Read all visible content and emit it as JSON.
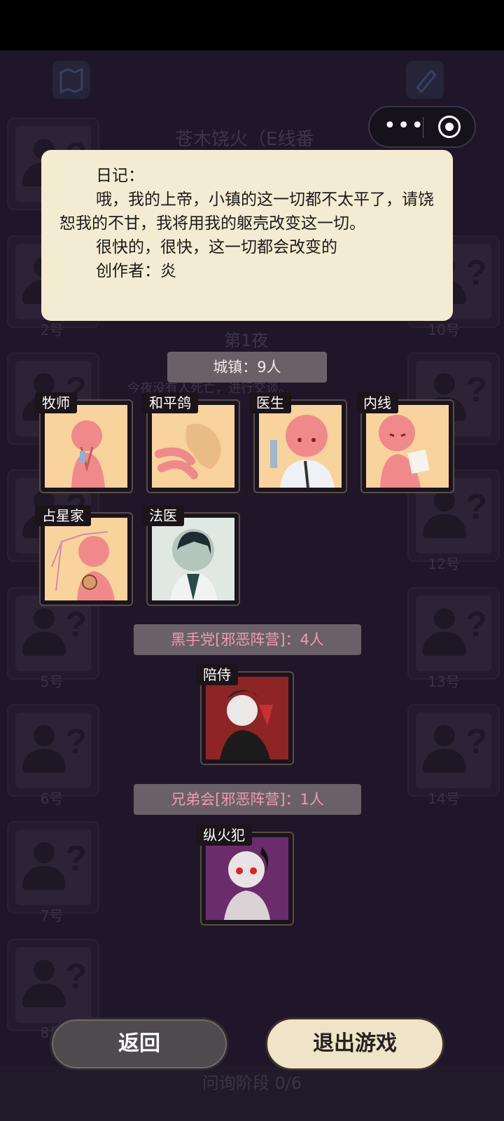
{
  "background": {
    "top_title": "苍木饶火（E线番",
    "night_label": "第1夜",
    "night_message": "今夜没有人死亡，进行交谈。",
    "seat_labels": [
      "2号",
      "10号",
      "12号",
      "5号",
      "13号",
      "6号",
      "14号",
      "7号",
      "8号"
    ],
    "phase_label": "问询阶段 0/6"
  },
  "capsule": {
    "more": "•••"
  },
  "diary": {
    "heading": "日记：",
    "lines": [
      "哦，我的上帝，小镇的这一切都不太平了，请饶恕我的不甘，我将用我的躯壳改变这一切。",
      "很快的，很快，这一切都会改变的",
      "创作者：炎"
    ]
  },
  "groups": {
    "town": {
      "label": "城镇：9人"
    },
    "black_hand": {
      "label": "黑手党[邪恶阵营]：4人"
    },
    "brotherhood": {
      "label": "兄弟会[邪恶阵营]：1人"
    }
  },
  "roles": {
    "town": [
      "牧师",
      "和平鸽",
      "医生",
      "内线",
      "占星家",
      "法医"
    ],
    "black_hand": [
      "陪侍"
    ],
    "brotherhood": [
      "纵火犯"
    ]
  },
  "buttons": {
    "back": "返回",
    "exit": "退出游戏"
  },
  "colors": {
    "page_bg": "#1f1729",
    "diary_bg": "#f3ebd2",
    "card_art": "#f8d39c",
    "evil_text": "#f09ab0"
  }
}
